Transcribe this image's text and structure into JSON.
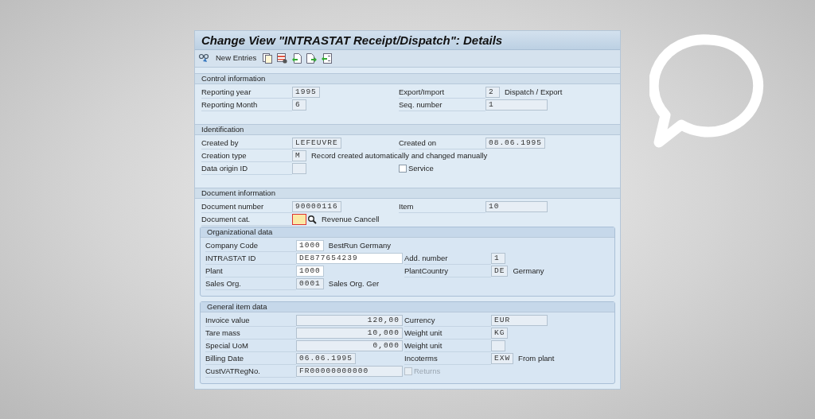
{
  "window": {
    "title": "Change View \"INTRASTAT Receipt/Dispatch\": Details"
  },
  "toolbar": {
    "items": [
      {
        "kind": "glasses"
      },
      {
        "kind": "text",
        "label": "New Entries"
      },
      {
        "kind": "copy"
      },
      {
        "kind": "delete"
      },
      {
        "kind": "undo"
      },
      {
        "kind": "next"
      },
      {
        "kind": "prev"
      }
    ]
  },
  "sections": [
    {
      "title": "Control information",
      "nested": false,
      "rows": [
        {
          "left": {
            "label": "Reporting year",
            "field": {
              "value": "1995",
              "kind": "text",
              "editable": false
            }
          },
          "right": {
            "label": "Export/Import",
            "field": {
              "value": "2",
              "kind": "text",
              "editable": false
            },
            "text": "Dispatch / Export"
          }
        },
        {
          "left": {
            "label": "Reporting Month",
            "field": {
              "value": "6",
              "kind": "text",
              "editable": false
            }
          },
          "right": {
            "label": "Seq. number",
            "field": {
              "value": "1",
              "kind": "wide",
              "editable": false
            }
          }
        }
      ]
    },
    {
      "title": "Identification",
      "nested": false,
      "rows": [
        {
          "left": {
            "label": "Created by",
            "field": {
              "value": "LEFEUVRE",
              "kind": "text",
              "editable": false
            }
          },
          "right": {
            "label": "Created on",
            "field": {
              "value": "08.06.1995",
              "kind": "text",
              "editable": false
            }
          }
        },
        {
          "left": {
            "label": "Creation type",
            "field": {
              "value": "M",
              "kind": "text",
              "editable": false
            },
            "text": "Record created automatically and changed manually"
          }
        },
        {
          "left": {
            "label": "Data origin ID",
            "field": {
              "kind": "text",
              "editable": false
            }
          },
          "right": {
            "checkbox": {
              "label": "Service",
              "checked": false,
              "disabled": false
            }
          }
        }
      ]
    },
    {
      "title": "Document information",
      "nested": false,
      "rows": [
        {
          "left": {
            "label": "Document number",
            "field": {
              "value": "90000116",
              "kind": "text",
              "editable": false
            }
          },
          "right": {
            "label": "Item",
            "field": {
              "value": "10",
              "kind": "wide",
              "editable": false
            }
          }
        },
        {
          "left": {
            "label": "Document cat.",
            "field": {
              "kind": "required",
              "editable": true
            },
            "search": true,
            "text": "Revenue Cancell"
          }
        }
      ],
      "groups": [
        {
          "title": "Organizational data",
          "nested": true,
          "rows": [
            {
              "left": {
                "label": "Company Code",
                "field": {
                  "value": "1000",
                  "kind": "text",
                  "editable": true
                },
                "text": "BestRun Germany"
              }
            },
            {
              "left": {
                "label": "INTRASTAT ID",
                "field": {
                  "value": "DE877654239",
                  "kind": "wide",
                  "editable": true
                }
              },
              "right": {
                "label": "Add. number",
                "field": {
                  "value": "1",
                  "kind": "text",
                  "editable": false
                }
              }
            },
            {
              "left": {
                "label": "Plant",
                "field": {
                  "value": "1000",
                  "kind": "text",
                  "editable": true
                }
              },
              "right": {
                "label": "PlantCountry",
                "field": {
                  "value": "DE",
                  "kind": "text",
                  "editable": false
                },
                "text": "Germany"
              }
            },
            {
              "left": {
                "label": "Sales Org.",
                "field": {
                  "value": "0001",
                  "kind": "text",
                  "editable": false
                },
                "text": "Sales Org. Ger"
              }
            }
          ]
        },
        {
          "title": "General item data",
          "nested": true,
          "rows": [
            {
              "left": {
                "label": "Invoice value",
                "field": {
                  "value": "120,00",
                  "kind": "number",
                  "editable": false
                }
              },
              "right": {
                "label": "Currency",
                "field": {
                  "value": "EUR",
                  "kind": "wide",
                  "editable": false
                }
              }
            },
            {
              "left": {
                "label": "Tare mass",
                "field": {
                  "value": "10,000",
                  "kind": "number",
                  "editable": false
                }
              },
              "right": {
                "label": "Weight unit",
                "field": {
                  "value": "KG",
                  "kind": "text",
                  "editable": false
                }
              }
            },
            {
              "left": {
                "label": "Special UoM",
                "field": {
                  "value": "0,000",
                  "kind": "number",
                  "editable": false
                }
              },
              "right": {
                "label": "Weight unit",
                "field": {
                  "kind": "text",
                  "editable": false
                }
              }
            },
            {
              "left": {
                "label": "Billing Date",
                "field": {
                  "value": "06.06.1995",
                  "kind": "text",
                  "editable": false
                }
              },
              "right": {
                "label": "Incoterms",
                "field": {
                  "value": "EXW",
                  "kind": "text",
                  "editable": false
                },
                "text": "From plant"
              }
            },
            {
              "left": {
                "label": "CustVATRegNo.",
                "field": {
                  "value": "FR00000000000",
                  "kind": "wide",
                  "editable": false
                }
              },
              "right": {
                "checkbox": {
                  "label": "Returns",
                  "checked": false,
                  "disabled": true
                }
              }
            }
          ]
        }
      ]
    }
  ]
}
